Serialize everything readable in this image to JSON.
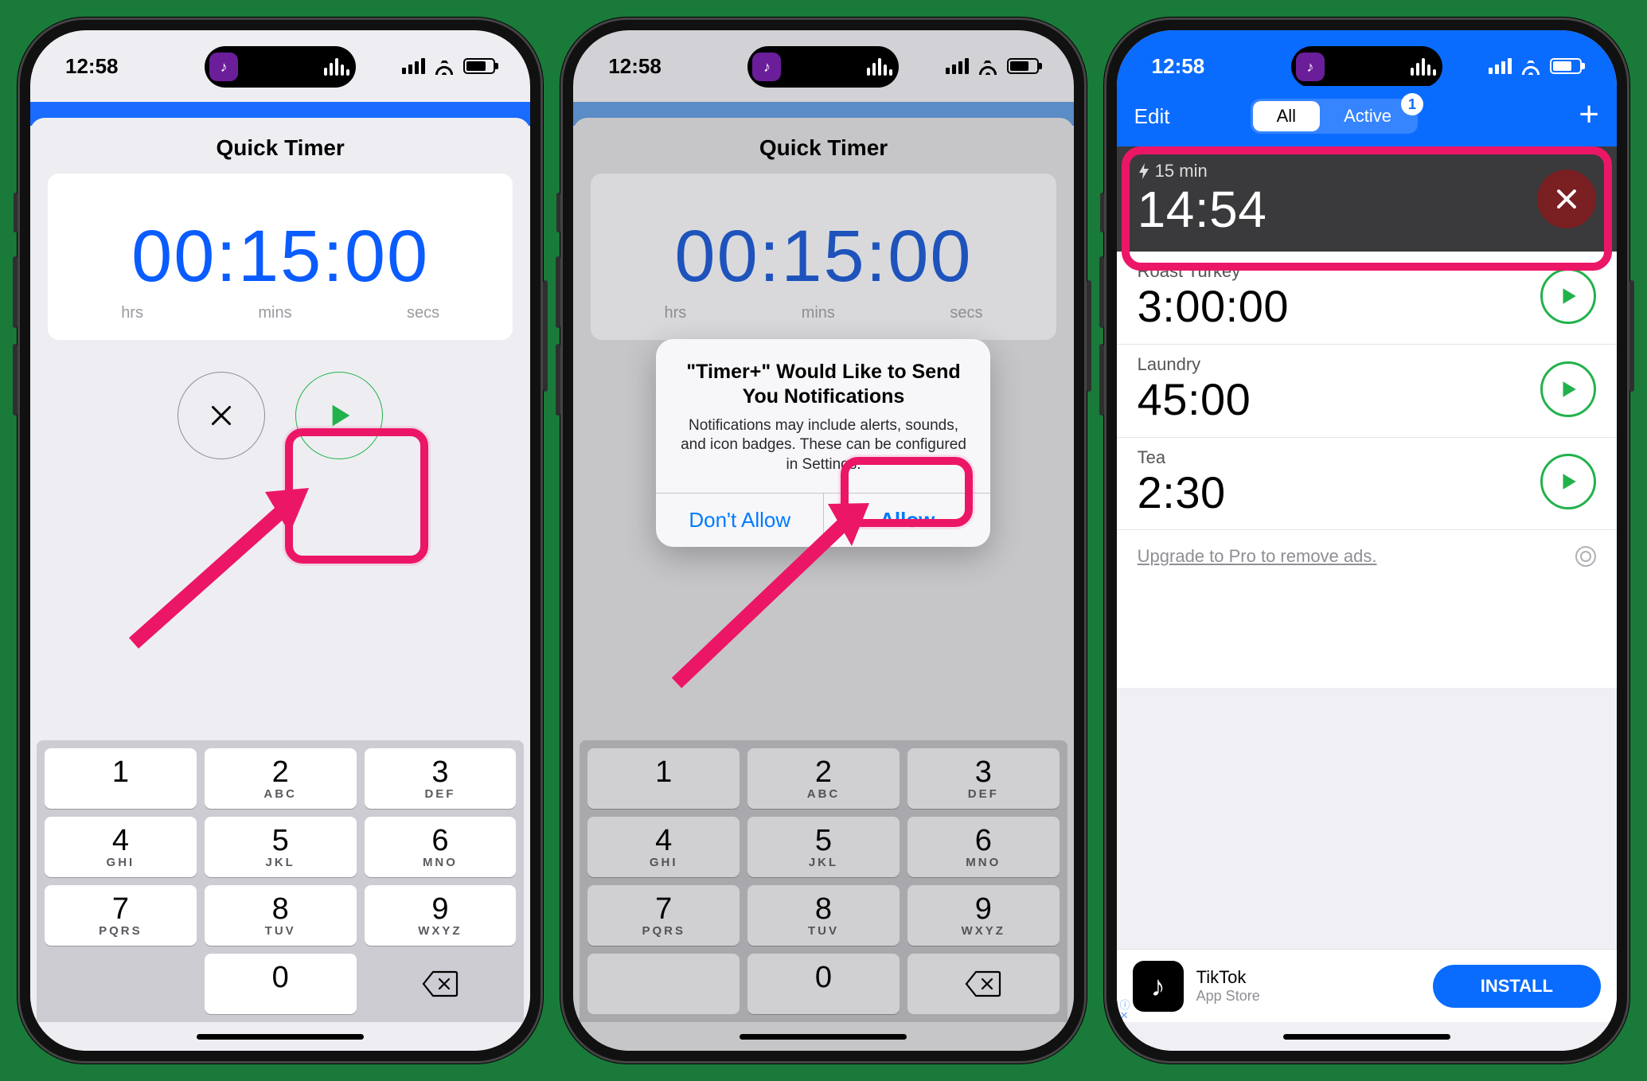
{
  "status_time": "12:58",
  "sheet_title": "Quick Timer",
  "timer_value": "00:15:00",
  "time_unit_labels": {
    "hrs": "hrs",
    "mins": "mins",
    "secs": "secs"
  },
  "keypad": [
    {
      "num": "1",
      "letters": ""
    },
    {
      "num": "2",
      "letters": "ABC"
    },
    {
      "num": "3",
      "letters": "DEF"
    },
    {
      "num": "4",
      "letters": "GHI"
    },
    {
      "num": "5",
      "letters": "JKL"
    },
    {
      "num": "6",
      "letters": "MNO"
    },
    {
      "num": "7",
      "letters": "PQRS"
    },
    {
      "num": "8",
      "letters": "TUV"
    },
    {
      "num": "9",
      "letters": "WXYZ"
    },
    {
      "blank": true
    },
    {
      "num": "0",
      "letters": ""
    },
    {
      "del": true
    }
  ],
  "alert": {
    "title": "\"Timer+\" Would Like to Send You Notifications",
    "body": "Notifications may include alerts, sounds, and icon badges. These can be configured in Settings.",
    "deny": "Don't Allow",
    "allow": "Allow"
  },
  "navbar": {
    "edit": "Edit",
    "seg_all": "All",
    "seg_active": "Active",
    "active_badge": "1",
    "plus": "+"
  },
  "timers": {
    "running": {
      "label": "15 min",
      "value": "14:54"
    },
    "rows": [
      {
        "name": "Roast Turkey",
        "value": "3:00:00"
      },
      {
        "name": "Laundry",
        "value": "45:00"
      },
      {
        "name": "Tea",
        "value": "2:30"
      }
    ]
  },
  "upgrade_text": "Upgrade to Pro to remove ads.",
  "ad": {
    "title": "TikTok",
    "subtitle": "App Store",
    "cta": "INSTALL"
  },
  "colors": {
    "accent": "#0a6bff",
    "play": "#22b24c",
    "highlight": "#ec1667"
  }
}
